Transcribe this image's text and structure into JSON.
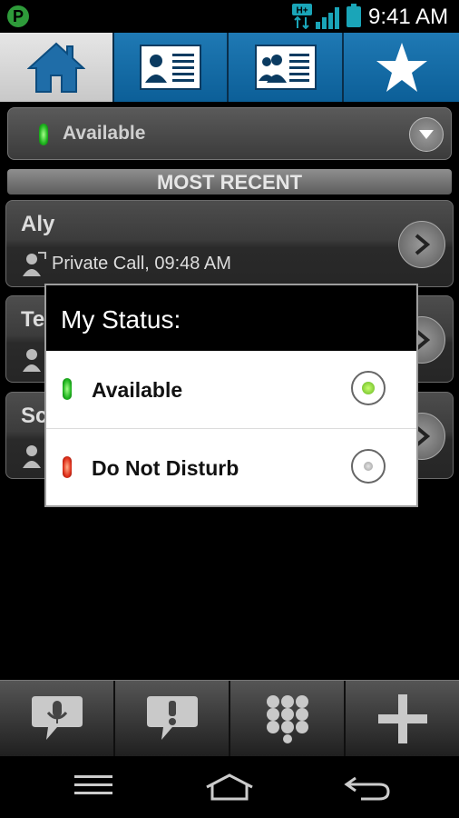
{
  "status_bar": {
    "app_icon_letter": "P",
    "network": "H+",
    "time": "9:41 AM"
  },
  "tabs": [
    {
      "name": "home",
      "active": true
    },
    {
      "name": "contact-card",
      "active": false
    },
    {
      "name": "group-card",
      "active": false
    },
    {
      "name": "favorites",
      "active": false
    }
  ],
  "status_dropdown": {
    "label": "Available",
    "led_color": "#1fb51f"
  },
  "section": {
    "title": "MOST RECENT"
  },
  "recent": [
    {
      "name": "Aly",
      "detail": "Private Call, 09:48 AM"
    },
    {
      "name": "Te",
      "detail": ""
    },
    {
      "name": "Sc",
      "detail": ""
    }
  ],
  "dialog": {
    "title": "My Status:",
    "options": [
      {
        "label": "Available",
        "selected": true,
        "led_color": "#1fb51f"
      },
      {
        "label": "Do Not Disturb",
        "selected": false,
        "led_color": "#e0301b"
      }
    ]
  },
  "toolbar": {
    "items": [
      {
        "icon": "microphone-bubble-icon"
      },
      {
        "icon": "alert-bubble-icon"
      },
      {
        "icon": "keypad-icon"
      },
      {
        "icon": "plus-icon"
      }
    ]
  },
  "nav": {
    "items": [
      "menu-icon",
      "home-icon",
      "back-icon"
    ]
  }
}
